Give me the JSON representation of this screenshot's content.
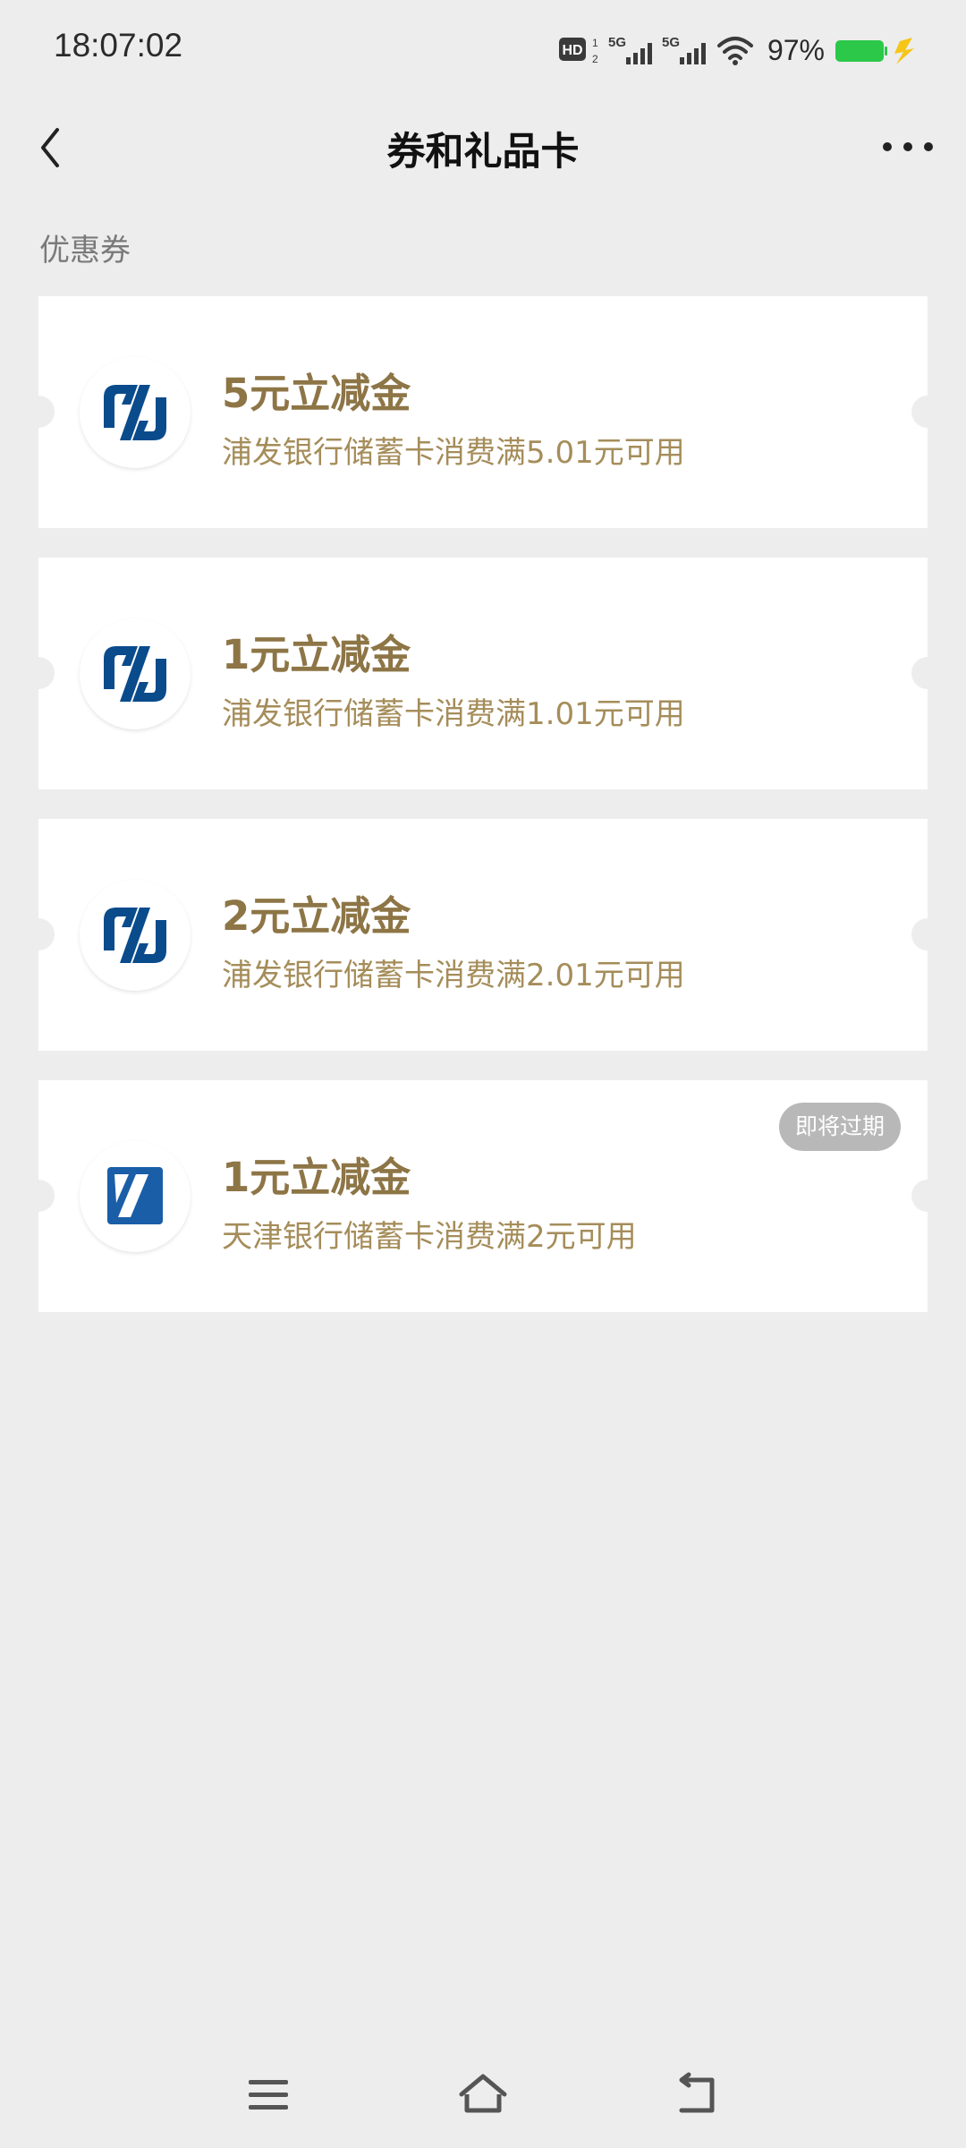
{
  "status_bar": {
    "time": "18:07:02",
    "battery_percent": "97%",
    "network_labels": [
      "HD",
      "5G",
      "5G"
    ]
  },
  "nav": {
    "title": "券和礼品卡"
  },
  "section": {
    "label": "优惠券"
  },
  "coupons": [
    {
      "title": "5元立减金",
      "desc": "浦发银行储蓄卡消费满5.01元可用",
      "bank_icon": "spdb-logo-icon"
    },
    {
      "title": "1元立减金",
      "desc": "浦发银行储蓄卡消费满1.01元可用",
      "bank_icon": "spdb-logo-icon"
    },
    {
      "title": "2元立减金",
      "desc": "浦发银行储蓄卡消费满2.01元可用",
      "bank_icon": "spdb-logo-icon"
    },
    {
      "title": "1元立减金",
      "desc": "天津银行储蓄卡消费满2元可用",
      "bank_icon": "tjbank-logo-icon",
      "badge": "即将过期"
    }
  ],
  "colors": {
    "accent_gold": "#8d7546",
    "spdb_blue": "#0a4b8c",
    "tjbank_blue": "#1a5ea8",
    "battery_green": "#2bc84a",
    "badge_grey": "#b8b8b8"
  }
}
